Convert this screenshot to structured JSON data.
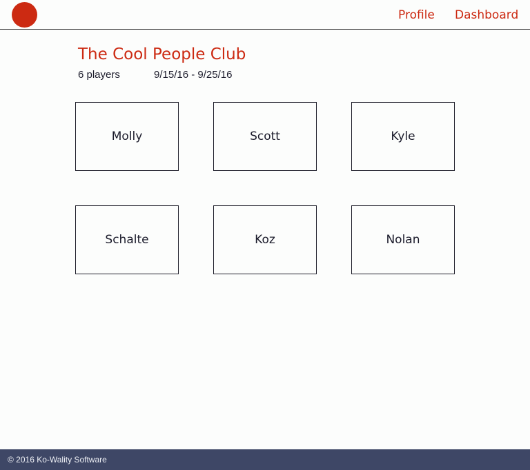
{
  "colors": {
    "accent": "#cc2a12",
    "footer_bg": "#3e4766"
  },
  "header": {
    "logo_icon": "red-circle-logo-icon",
    "nav": {
      "profile": "Profile",
      "dashboard": "Dashboard"
    }
  },
  "club": {
    "name": "The Cool People Club",
    "player_count": "6 players",
    "date_range": "9/15/16 - 9/25/16"
  },
  "players": [
    "Molly",
    "Scott",
    "Kyle",
    "Schalte",
    "Koz",
    "Nolan"
  ],
  "footer": {
    "copyright": "© 2016 Ko-Wality Software"
  }
}
